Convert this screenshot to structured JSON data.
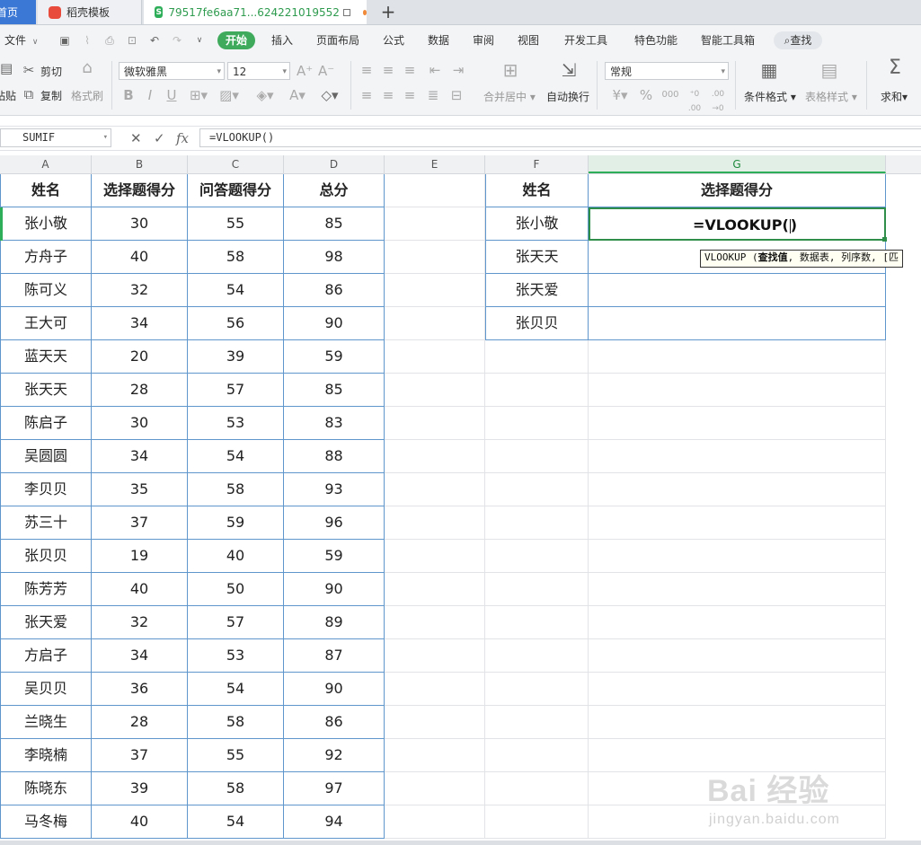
{
  "tabs": [
    {
      "label": "首页"
    },
    {
      "label": "稻壳模板"
    },
    {
      "label": "79517fe6aa71...624221019552"
    }
  ],
  "menu": {
    "file": "文件",
    "items": [
      "开始",
      "插入",
      "页面布局",
      "公式",
      "数据",
      "审阅",
      "视图",
      "开发工具",
      "特色功能",
      "智能工具箱"
    ],
    "search": "查找"
  },
  "ribbon": {
    "cut": "剪切",
    "paste": "粘贴",
    "copy": "复制",
    "format_painter": "格式刷",
    "font_name": "微软雅黑",
    "font_size": "12",
    "merge_center": "合并居中",
    "wrap_text": "自动换行",
    "number_format": "常规",
    "conditional_format": "条件格式",
    "table_style": "表格样式",
    "sum": "求和"
  },
  "formula_bar": {
    "name_box": "SUMIF",
    "formula": "=VLOOKUP()"
  },
  "columns": [
    "A",
    "B",
    "C",
    "D",
    "E",
    "F",
    "G"
  ],
  "main_table": {
    "headers": [
      "姓名",
      "选择题得分",
      "问答题得分",
      "总分"
    ],
    "rows": [
      [
        "张小敬",
        "30",
        "55",
        "85"
      ],
      [
        "方舟子",
        "40",
        "58",
        "98"
      ],
      [
        "陈可义",
        "32",
        "54",
        "86"
      ],
      [
        "王大可",
        "34",
        "56",
        "90"
      ],
      [
        "蓝天天",
        "20",
        "39",
        "59"
      ],
      [
        "张天天",
        "28",
        "57",
        "85"
      ],
      [
        "陈启子",
        "30",
        "53",
        "83"
      ],
      [
        "吴圆圆",
        "34",
        "54",
        "88"
      ],
      [
        "李贝贝",
        "35",
        "58",
        "93"
      ],
      [
        "苏三十",
        "37",
        "59",
        "96"
      ],
      [
        "张贝贝",
        "19",
        "40",
        "59"
      ],
      [
        "陈芳芳",
        "40",
        "50",
        "90"
      ],
      [
        "张天爱",
        "32",
        "57",
        "89"
      ],
      [
        "方启子",
        "34",
        "53",
        "87"
      ],
      [
        "吴贝贝",
        "36",
        "54",
        "90"
      ],
      [
        "兰晓生",
        "28",
        "58",
        "86"
      ],
      [
        "李晓楠",
        "37",
        "55",
        "92"
      ],
      [
        "陈晓东",
        "39",
        "58",
        "97"
      ],
      [
        "马冬梅",
        "40",
        "54",
        "94"
      ]
    ]
  },
  "lookup_table": {
    "headers": [
      "姓名",
      "选择题得分"
    ],
    "names": [
      "张小敬",
      "张天天",
      "张天爱",
      "张贝贝"
    ],
    "active_cell_text": "=VLOOKUP(",
    "active_cell_close": ")"
  },
  "tooltip": {
    "func": "VLOOKUP (",
    "arg1": "查找值",
    "rest": ", 数据表, 列序数, [匹"
  },
  "watermark": {
    "brand": "Bai  经验",
    "sub": "jingyan.baidu.com"
  },
  "colors": {
    "accent_green": "#2eae59",
    "table_border": "#5f97cc",
    "active_border": "#2f8f4a"
  }
}
